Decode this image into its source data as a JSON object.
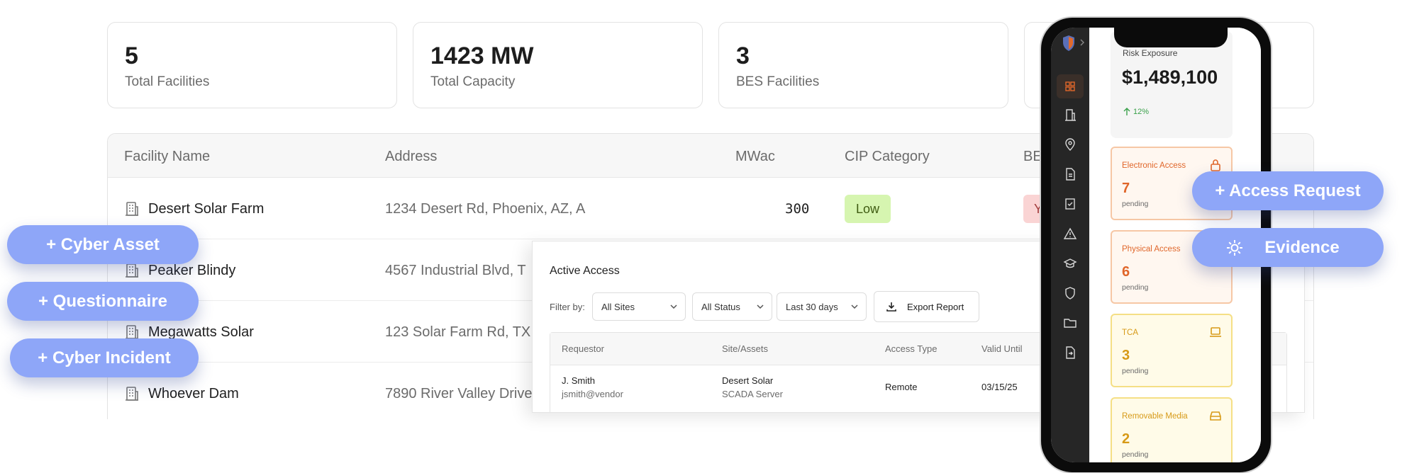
{
  "stats": [
    {
      "value": "5",
      "label": "Total Facilities"
    },
    {
      "value": "1423 MW",
      "label": "Total Capacity"
    },
    {
      "value": "3",
      "label": "BES Facilities"
    }
  ],
  "facilities": {
    "headers": {
      "name": "Facility Name",
      "address": "Address",
      "mwac": "MWac",
      "cip": "CIP Category",
      "bes": "BE"
    },
    "rows": [
      {
        "name": "Desert Solar Farm",
        "address": "1234 Desert Rd, Phoenix, AZ, A",
        "mwac": "300",
        "cip": "Low",
        "bes": "Y"
      },
      {
        "name": "Peaker Blindy",
        "address": "4567 Industrial Blvd, T"
      },
      {
        "name": "Megawatts Solar",
        "address": "123 Solar Farm Rd, TX,"
      },
      {
        "name": "Whoever Dam",
        "address": "7890 River Valley Drive"
      }
    ]
  },
  "quick_actions": {
    "cyber_asset": "+ Cyber Asset",
    "questionnaire": "+ Questionnaire",
    "cyber_incident": "+ Cyber Incident",
    "access_request": "+ Access Request",
    "evidence": "Evidence"
  },
  "active_access": {
    "title": "Active Access",
    "filter_label": "Filter by:",
    "filters": {
      "sites": "All Sites",
      "status": "All Status",
      "range": "Last 30 days"
    },
    "export_label": "Export Report",
    "columns": {
      "requestor": "Requestor",
      "site": "Site/Assets",
      "type": "Access Type",
      "valid": "Valid Until"
    },
    "rows": [
      {
        "requestor": "J. Smith",
        "email": "jsmith@vendor",
        "site": "Desert Solar",
        "asset": "SCADA Server",
        "type": "Remote",
        "valid": "03/15/25"
      }
    ]
  },
  "mobile": {
    "risk": {
      "title": "Risk Exposure",
      "value": "$1,489,100",
      "change": "12%"
    },
    "cards": [
      {
        "title": "Electronic Access",
        "count": "7",
        "sub": "pending",
        "icon": "lock-icon"
      },
      {
        "title": "Physical Access",
        "count": "6",
        "sub": "pending",
        "icon": "badge-icon"
      },
      {
        "title": "TCA",
        "count": "3",
        "sub": "pending",
        "icon": "laptop-icon"
      },
      {
        "title": "Removable Media",
        "count": "2",
        "sub": "pending",
        "icon": "drive-icon"
      }
    ],
    "accent": "#e0662a"
  }
}
